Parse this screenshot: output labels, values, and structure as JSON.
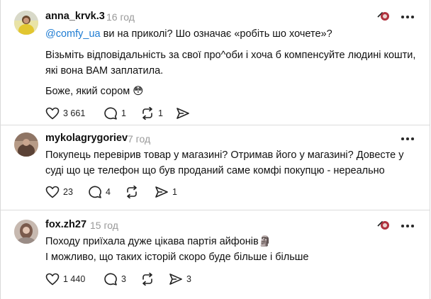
{
  "comments": [
    {
      "username": "anna_krvk.3",
      "time": "16 год",
      "mention": "@comfy_ua",
      "lines": [
        " ви на приколі? Шо означає «робіть шо хочете»?",
        "Візьміть відповідальність за свої про^оби і хоча б компенсуйте людині кошти,",
        "які вона ВАМ заплатила.",
        "Боже, який сором 😳"
      ],
      "likes": "3 661",
      "replies": "1",
      "reposts": "1",
      "shares": ""
    },
    {
      "username": "mykolagrygoriev",
      "time": "7 год",
      "lines": [
        "Покупець перевірив товар у магазині? Отримав його у магазині? Довесте у",
        "суді що це телефон що був проданий саме комфі покупцю - нереально"
      ],
      "likes": "23",
      "replies": "4",
      "reposts": "",
      "shares": "1"
    },
    {
      "username": "fox.zh27",
      "time": "15 год",
      "lines": [
        "Походу приїхала дуже цікава партія айфонів🗿",
        "І можливо, що таких історій скоро буде більше і більше"
      ],
      "likes": "1 440",
      "replies": "3",
      "reposts": "",
      "shares": "3"
    }
  ],
  "colors": {
    "mention": "#1d7bd2",
    "time": "#999999",
    "text": "#101010",
    "divider": "#dcdcdc"
  },
  "icons": [
    "heart-icon",
    "comment-icon",
    "repost-icon",
    "share-icon",
    "more-icon",
    "avatar"
  ]
}
